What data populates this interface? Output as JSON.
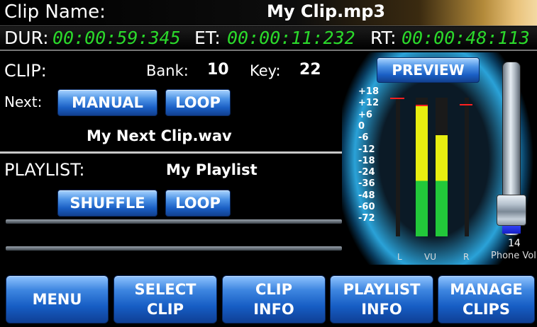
{
  "header": {
    "clip_name_label": "Clip Name:",
    "clip_name_value": "My Clip.mp3",
    "dur_label": "DUR:",
    "dur_value": "00:00:59:345",
    "et_label": "ET:",
    "et_value": "00:00:11:232",
    "rt_label": "RT:",
    "rt_value": "00:00:48:113"
  },
  "clip": {
    "label": "CLIP:",
    "bank_label": "Bank:",
    "bank_value": "10",
    "key_label": "Key:",
    "key_value": "22",
    "next_label": "Next:",
    "manual_button": "MANUAL",
    "loop_button": "LOOP",
    "next_clip": "My Next Clip.wav"
  },
  "playlist": {
    "label": "PLAYLIST:",
    "name": "My Playlist",
    "shuffle_button": "SHUFFLE",
    "loop_button": "LOOP"
  },
  "meter": {
    "preview_button": "PREVIEW",
    "scale": [
      "+18",
      "+12",
      "+6",
      "0",
      "-6",
      "-12",
      "-18",
      "-24",
      "-36",
      "-48",
      "-60",
      "-72"
    ],
    "left_label": "L",
    "vu_label": "VU",
    "right_label": "R",
    "vu_left_level": 0.95,
    "vu_right_level": 0.73,
    "colors": {
      "green": "#22c83a",
      "yellow": "#e8ee10",
      "red": "#ff2020"
    }
  },
  "volume": {
    "value": "14",
    "label": "Phone Vol",
    "level": 0.2
  },
  "bottom_buttons": [
    "MENU",
    "SELECT\nCLIP",
    "CLIP\nINFO",
    "PLAYLIST\nINFO",
    "MANAGE\nCLIPS"
  ]
}
